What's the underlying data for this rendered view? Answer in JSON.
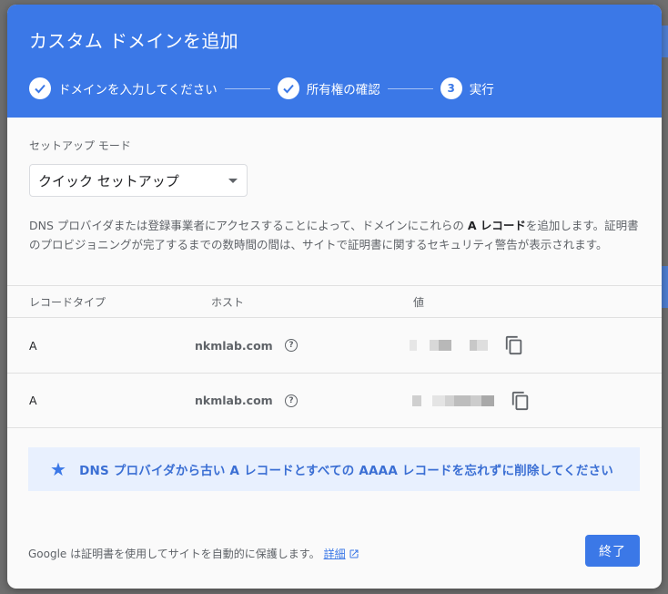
{
  "dialog": {
    "title": "カスタム ドメインを追加",
    "steps": [
      {
        "label": "ドメインを入力してください",
        "state": "done"
      },
      {
        "label": "所有権の確認",
        "state": "done"
      },
      {
        "label": "実行",
        "number": "3",
        "state": "active"
      }
    ],
    "mode_label": "セットアップ モード",
    "mode_value": "クイック セットアップ",
    "description_pre": "DNS プロバイダまたは登録事業者にアクセスすることによって、ドメインにこれらの ",
    "description_bold": "A レコード",
    "description_post": "を追加します。証明書のプロビジョニングが完了するまでの数時間の間は、サイトで証明書に関するセキュリティ警告が表示されます。",
    "table": {
      "headers": {
        "type": "レコードタイプ",
        "host": "ホスト",
        "value": "値"
      },
      "rows": [
        {
          "type": "A",
          "host": "nkmlab.com",
          "help": "?"
        },
        {
          "type": "A",
          "host": "nkmlab.com",
          "help": "?"
        }
      ]
    },
    "banner": "DNS プロバイダから古い A レコードとすべての AAAA レコードを忘れずに削除してください",
    "footer_note": "Google は証明書を使用してサイトを自動的に保護します。",
    "footer_link": "詳細",
    "done_button": "終了"
  },
  "colors": {
    "accent": "#3b78e7",
    "banner_bg": "#e8f0fe"
  }
}
